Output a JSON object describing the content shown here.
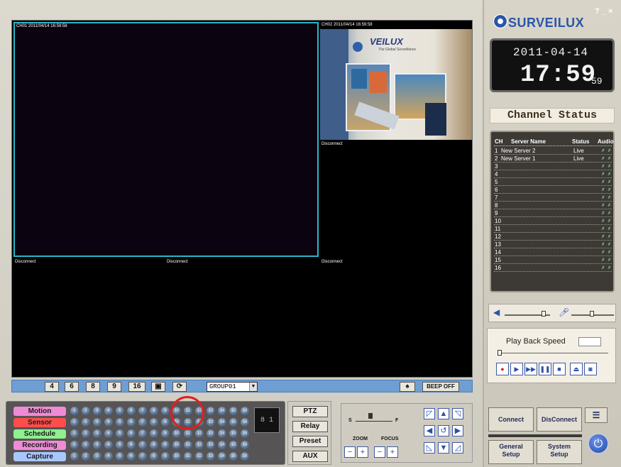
{
  "video": {
    "tiles": [
      {
        "label": "CH01  2011/04/14 16:59:58"
      },
      {
        "label": "CH02  2011/04/14 16:59:58"
      },
      {
        "label": "Disconnect"
      },
      {
        "label": "Disconnect"
      },
      {
        "label": "Disconnect"
      },
      {
        "label": "Disconnect"
      }
    ],
    "camera_image": {
      "logo_text": "VEILUX",
      "tagline": "The Global Surveillance"
    }
  },
  "toolbar": {
    "split_buttons": [
      "4",
      "6",
      "8",
      "9",
      "16"
    ],
    "fullscreen_icon": "fullscreen-icon",
    "sequence_icon": "sequence-icon",
    "group_value": "GROUP01",
    "beep_label": "BEEP OFF",
    "siren_icon": "siren-icon"
  },
  "alarm_panel": {
    "rows": [
      {
        "label": "Motion",
        "color": "#f08ad6"
      },
      {
        "label": "Sensor",
        "color": "#ff4d4d"
      },
      {
        "label": "Schedule",
        "color": "#8ef08e"
      },
      {
        "label": "Recording",
        "color": "#f08ad6"
      },
      {
        "label": "Capture",
        "color": "#a9c7ff"
      }
    ],
    "channels": [
      "1",
      "2",
      "3",
      "4",
      "5",
      "6",
      "7",
      "8",
      "9",
      "10",
      "11",
      "12",
      "13",
      "14",
      "15",
      "16"
    ],
    "channel_display": "8 1"
  },
  "side_buttons": [
    "PTZ",
    "Relay",
    "Preset",
    "AUX"
  ],
  "ptz": {
    "speed_slow": "S",
    "speed_fast": "F",
    "zoom_label": "ZOOM",
    "focus_label": "FOCUS"
  },
  "header": {
    "brand": "SURVEILUX",
    "window_controls": "? _ ×"
  },
  "clock": {
    "date": "2011-04-14",
    "time": "17:59",
    "seconds": "59"
  },
  "channel_status": {
    "title": "Channel  Status",
    "columns": [
      "CH",
      "Server Name",
      "Status",
      "Audio"
    ],
    "rows": [
      {
        "ch": "1",
        "server": "New Server 2",
        "status": "Live"
      },
      {
        "ch": "2",
        "server": "New Server 1",
        "status": "Live"
      },
      {
        "ch": "3",
        "server": "",
        "status": ""
      },
      {
        "ch": "4",
        "server": "",
        "status": ""
      },
      {
        "ch": "5",
        "server": "",
        "status": ""
      },
      {
        "ch": "6",
        "server": "",
        "status": ""
      },
      {
        "ch": "7",
        "server": "",
        "status": ""
      },
      {
        "ch": "8",
        "server": "",
        "status": ""
      },
      {
        "ch": "9",
        "server": "",
        "status": ""
      },
      {
        "ch": "10",
        "server": "",
        "status": ""
      },
      {
        "ch": "11",
        "server": "",
        "status": ""
      },
      {
        "ch": "12",
        "server": "",
        "status": ""
      },
      {
        "ch": "13",
        "server": "",
        "status": ""
      },
      {
        "ch": "14",
        "server": "",
        "status": ""
      },
      {
        "ch": "15",
        "server": "",
        "status": ""
      },
      {
        "ch": "16",
        "server": "",
        "status": ""
      }
    ]
  },
  "playback": {
    "title": "Play Back Speed"
  },
  "system": {
    "connect": "Connect",
    "disconnect": "DisConnect",
    "general_setup": "General\nSetup",
    "system_setup": "System\nSetup"
  },
  "colors": {
    "accent_blue": "#2b56a8",
    "active_tile_border": "#28b6c8",
    "annotation_red": "#e11f1f"
  }
}
